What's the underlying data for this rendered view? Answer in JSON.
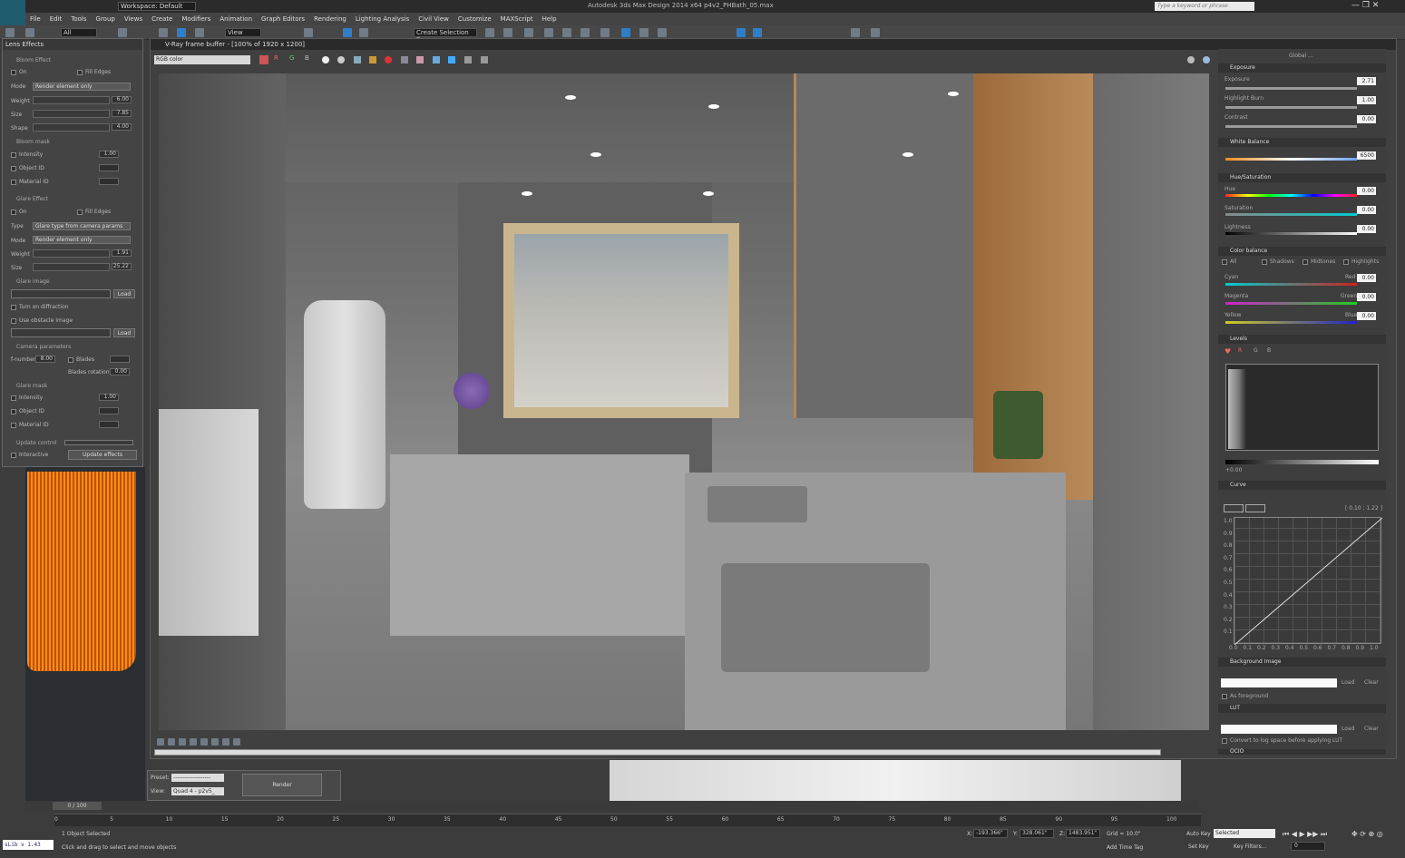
{
  "titlebar": {
    "workspace": "Workspace: Default",
    "app_title": "Autodesk 3ds Max Design 2014 x64     p4v2_PHBath_05.max",
    "search_placeholder": "Type a keyword or phrase"
  },
  "menu": [
    "File",
    "Edit",
    "Tools",
    "Group",
    "Views",
    "Create",
    "Modifiers",
    "Animation",
    "Graph Editors",
    "Rendering",
    "Lighting Analysis",
    "Civil View",
    "Customize",
    "MAXScript",
    "Help"
  ],
  "toolbar": {
    "selection_filter": "All",
    "view": "View",
    "named_selection": "Create Selection Se"
  },
  "lens": {
    "title": "Lens Effects",
    "bloom_header": "Bloom Effect",
    "on": "On",
    "fill_edges": "Fill Edges",
    "mode_label": "Mode",
    "mode_value": "Render element only",
    "weight": "Weight",
    "weight_val": "6.00",
    "size": "Size",
    "size_val": "7.85",
    "shape": "Shape",
    "shape_val": "4.00",
    "bloom_mask": "Bloom mask",
    "intensity": "Intensity",
    "intensity_val": "1.00",
    "object_id": "Object ID",
    "material_id": "Material ID",
    "glare_header": "Glare Effect",
    "glare_on": "On",
    "glare_fill": "Fill Edges",
    "type_label": "Type",
    "type_value": "Glare type from camera params",
    "glare_mode_label": "Mode",
    "glare_mode_value": "Render element only",
    "glare_weight": "Weight",
    "glare_weight_val": "1.91",
    "glare_size": "Size",
    "glare_size_val": "25.22",
    "glare_image": "Glare image",
    "load": "Load",
    "diffraction": "Turn on diffraction",
    "obstacle": "Use obstacle image",
    "cam_params": "Camera parameters",
    "fnumber": "f-number",
    "fnumber_val": "8.00",
    "blades": "Blades",
    "blades_rot": "Blades rotation",
    "blades_rot_val": "0.00",
    "glare_mask": "Glare mask",
    "gm_intensity": "Intensity",
    "gm_intensity_val": "1.00",
    "gm_object": "Object ID",
    "gm_material": "Material ID",
    "update_control": "Update control",
    "interactive": "Interactive",
    "update_effects": "Update effects"
  },
  "vfb": {
    "title": "V-Ray frame buffer - [100% of 1920 x 1200]",
    "channel": "RGB color",
    "r": "R",
    "g": "G",
    "b": "B"
  },
  "colorcorr": {
    "global": "Global ...",
    "exposure_hdr": "Exposure",
    "exposure": "Exposure",
    "exposure_val": "2.71",
    "highlight": "Highlight Burn",
    "highlight_val": "1.00",
    "contrast": "Contrast",
    "contrast_val": "0.00",
    "wb_hdr": "White Balance",
    "wb_val": "6500",
    "hs_hdr": "Hue/Saturation",
    "hue": "Hue",
    "hue_val": "0.00",
    "sat": "Saturation",
    "sat_val": "0.00",
    "light": "Lightness",
    "light_val": "0.00",
    "cb_hdr": "Color balance",
    "all": "All",
    "shadows": "Shadows",
    "midtones": "Midtones",
    "highlights": "Highlights",
    "cyan": "Cyan",
    "red": "Red",
    "cr_val": "0.00",
    "magenta": "Magenta",
    "green": "Green",
    "mg_val": "0.00",
    "yellow": "Yellow",
    "blue": "Blue",
    "yb_val": "0.00",
    "levels_hdr": "Levels",
    "lv_r": "R",
    "lv_g": "G",
    "lv_b": "B",
    "lv_min": "+0.00",
    "curve_hdr": "Curve",
    "curve_coord": "[ 0.10 ; 1.22 ]",
    "curve_y": [
      "1.0",
      "0.9",
      "0.8",
      "0.7",
      "0.6",
      "0.5",
      "0.4",
      "0.3",
      "0.2",
      "0.1"
    ],
    "curve_x": [
      "0.0",
      "0.1",
      "0.2",
      "0.3",
      "0.4",
      "0.5",
      "0.6",
      "0.7",
      "0.8",
      "0.9",
      "1.0"
    ],
    "bg_hdr": "Background Image",
    "bg_load": "Load",
    "bg_clear": "Clear",
    "as_fg": "As foreground",
    "lut_hdr": "LUT",
    "lut_load": "Load",
    "lut_clear": "Clear",
    "lut_log": "Convert to log space before applying LUT",
    "ocio": "OCIO"
  },
  "renderdlg": {
    "preset": "Preset:",
    "preset_val": "-------------------",
    "view": "View:",
    "view_val": "Quad 4 - p2v5_",
    "render": "Render"
  },
  "timeline": {
    "frame": "0 / 100",
    "ticks": [
      "0",
      "5",
      "10",
      "15",
      "20",
      "25",
      "30",
      "35",
      "40",
      "45",
      "50",
      "55",
      "60",
      "65",
      "70",
      "75",
      "80",
      "85",
      "90",
      "95",
      "100"
    ]
  },
  "status": {
    "script": "sLib v 1.43",
    "selected": "1 Object Selected",
    "hint": "Click and drag to select and move objects",
    "x_label": "X:",
    "x": "-193.366\"",
    "y_label": "Y:",
    "y": "328.061\"",
    "z_label": "Z:",
    "z": "1483.951\"",
    "grid": "Grid = 10.0\"",
    "add_tag": "Add Time Tag",
    "autokey": "Auto Key",
    "autokey_val": "Selected",
    "setkey": "Set Key",
    "keyfilters": "Key Filters...",
    "frame_val": "0"
  }
}
